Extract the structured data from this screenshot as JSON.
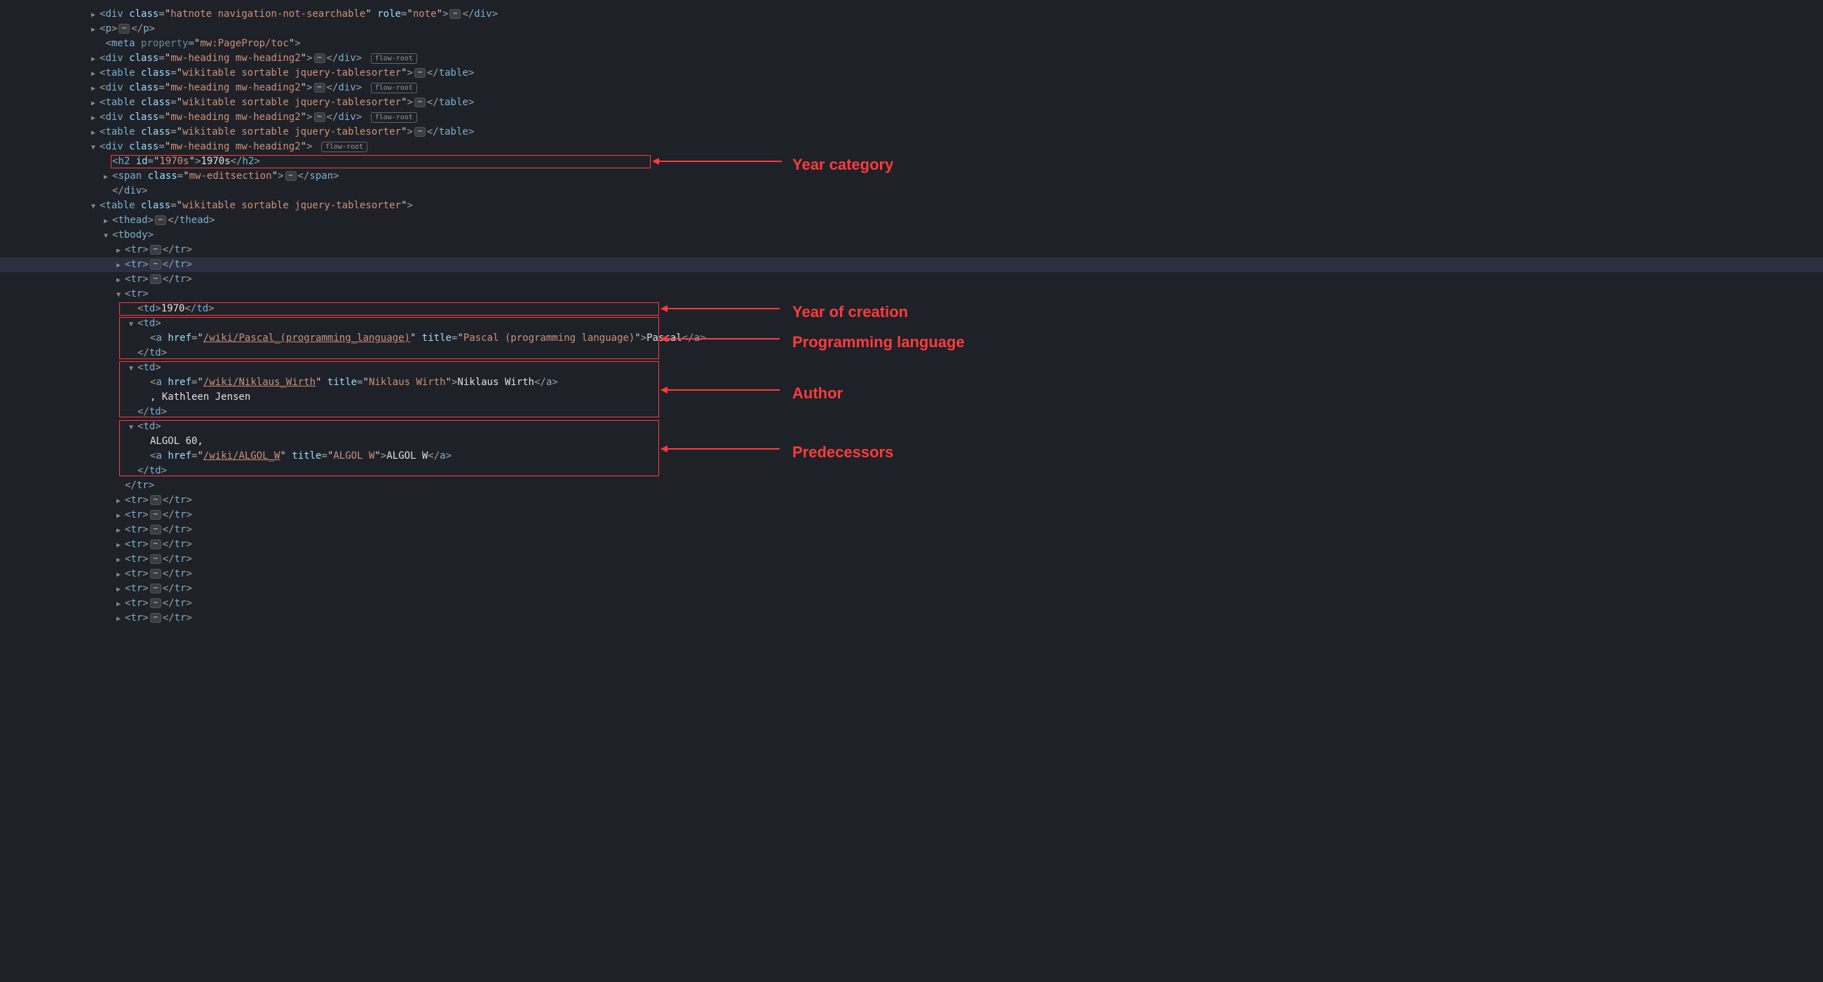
{
  "annotations": {
    "year_category": "Year category",
    "year_of_creation": "Year of creation",
    "programming_language": "Programming language",
    "author": "Author",
    "predecessors": "Predecessors"
  },
  "dom": {
    "hatnote": {
      "tag": "div",
      "class": "hatnote navigation-not-searchable",
      "role": "note"
    },
    "p": {
      "tag": "p"
    },
    "meta": {
      "tag": "meta",
      "property": "mw:PageProp/toc"
    },
    "heading_div_class": "mw-heading mw-heading2",
    "flow_root_label": "flow-root",
    "table_class": "wikitable sortable jquery-tablesorter",
    "heading_h2": {
      "id": "1970s",
      "text": "1970s"
    },
    "editsection_class": "mw-editsection",
    "thead": "thead",
    "tbody": "tbody",
    "tr": "tr",
    "td": "td",
    "div": "div",
    "table": "table",
    "span": "span",
    "h2": "h2",
    "a": "a",
    "row": {
      "year": "1970",
      "lang_cell": {
        "href": "/wiki/Pascal_(programming_language)",
        "title": "Pascal (programming language)",
        "text": "Pascal"
      },
      "author_cell": {
        "href": "/wiki/Niklaus_Wirth",
        "title": "Niklaus Wirth",
        "link_text": "Niklaus Wirth",
        "extra": ", Kathleen Jensen"
      },
      "pred_cell": {
        "prefix": "ALGOL 60,",
        "href": "/wiki/ALGOL_W",
        "title": "ALGOL W",
        "text": "ALGOL W"
      }
    }
  }
}
